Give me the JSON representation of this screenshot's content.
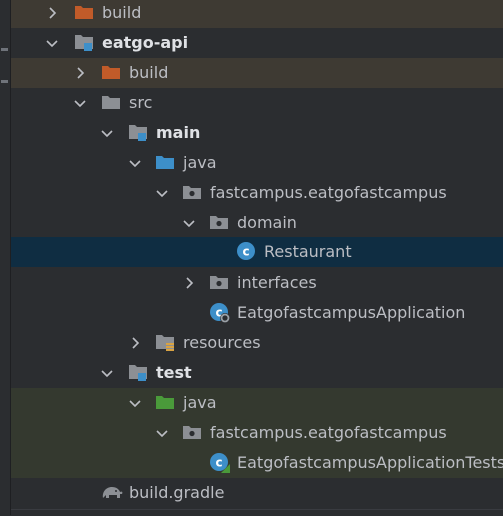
{
  "project_tree": {
    "items": [
      {
        "label": "build",
        "icon": "folder-excluded-icon"
      },
      {
        "label": "eatgo-api",
        "icon": "module-folder-icon"
      },
      {
        "label": "build",
        "icon": "folder-excluded-icon"
      },
      {
        "label": "src",
        "icon": "folder-icon"
      },
      {
        "label": "main",
        "icon": "source-set-folder-icon"
      },
      {
        "label": "java",
        "icon": "source-root-folder-icon"
      },
      {
        "label": "fastcampus.eatgofastcampus",
        "icon": "package-icon"
      },
      {
        "label": "domain",
        "icon": "package-icon"
      },
      {
        "label": "Restaurant",
        "icon": "class-icon"
      },
      {
        "label": "interfaces",
        "icon": "package-icon"
      },
      {
        "label": "EatgofastcampusApplication",
        "icon": "spring-boot-class-icon"
      },
      {
        "label": "resources",
        "icon": "resources-folder-icon"
      },
      {
        "label": "test",
        "icon": "source-set-folder-icon"
      },
      {
        "label": "java",
        "icon": "test-root-folder-icon"
      },
      {
        "label": "fastcampus.eatgofastcampus",
        "icon": "package-icon"
      },
      {
        "label": "EatgofastcampusApplicationTests",
        "icon": "spring-boot-test-class-icon"
      },
      {
        "label": "build.gradle",
        "icon": "gradle-elephant-icon"
      }
    ]
  },
  "colors": {
    "background": "#2b2d30",
    "selection": "#0f2d42",
    "excluded_folder": "#c15b29",
    "source_root": "#3d8fc9",
    "test_root": "#4a9a3a",
    "folder": "#8c8f94",
    "class_icon": "#3d8fc9"
  }
}
